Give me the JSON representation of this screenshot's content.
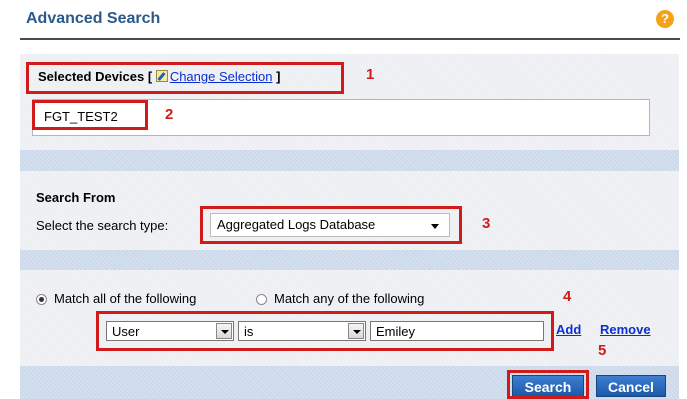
{
  "header": {
    "title": "Advanced Search",
    "help_icon": "?"
  },
  "selected_devices": {
    "label": "Selected Devices [",
    "change_selection": "Change Selection",
    "closing": "]",
    "devices": [
      "FGT_TEST2"
    ]
  },
  "search_from": {
    "heading": "Search From",
    "type_label": "Select the search type:",
    "type_value": "Aggregated Logs Database"
  },
  "match": {
    "all_label": "Match all of the following",
    "any_label": "Match any of the following",
    "selected": "all",
    "condition": {
      "field": "User",
      "operator": "is",
      "value": "Emiley"
    },
    "add_label": "Add",
    "remove_label": "Remove"
  },
  "buttons": {
    "search": "Search",
    "cancel": "Cancel"
  },
  "annotations": [
    "1",
    "2",
    "3",
    "4",
    "5"
  ],
  "colors": {
    "accent": "#2b5a8a",
    "highlight": "#d11b1b",
    "button": "#1c58a8"
  }
}
